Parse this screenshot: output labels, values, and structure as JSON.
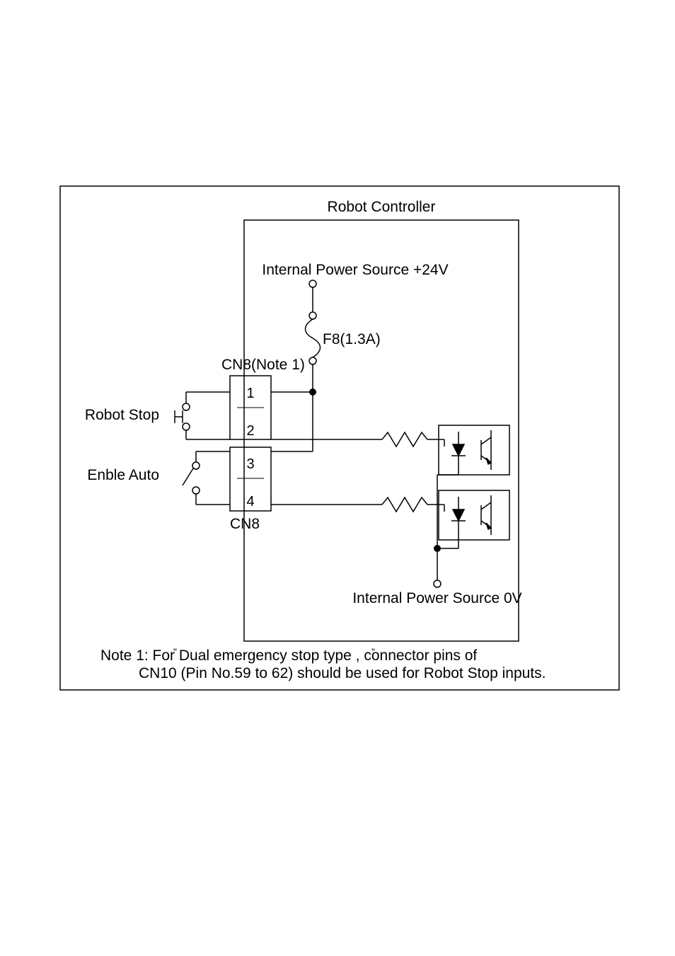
{
  "labels": {
    "controller": "Robot Controller",
    "power24": "Internal Power Source +24V",
    "fuse": "F8(1.3A)",
    "cn8note": "CN8(Note 1)",
    "robotStop": "Robot Stop",
    "enableAuto": "Enble Auto",
    "cn8": "CN8",
    "power0": "Internal Power Source 0V",
    "note_line1": "Note 1: For Dual emergency stop type , connector pins of",
    "note_line2": "CN10 (Pin No.59 to 62) should be used for Robot Stop inputs."
  },
  "pins": {
    "p1": "1",
    "p2": "2",
    "p3": "3",
    "p4": "4"
  }
}
